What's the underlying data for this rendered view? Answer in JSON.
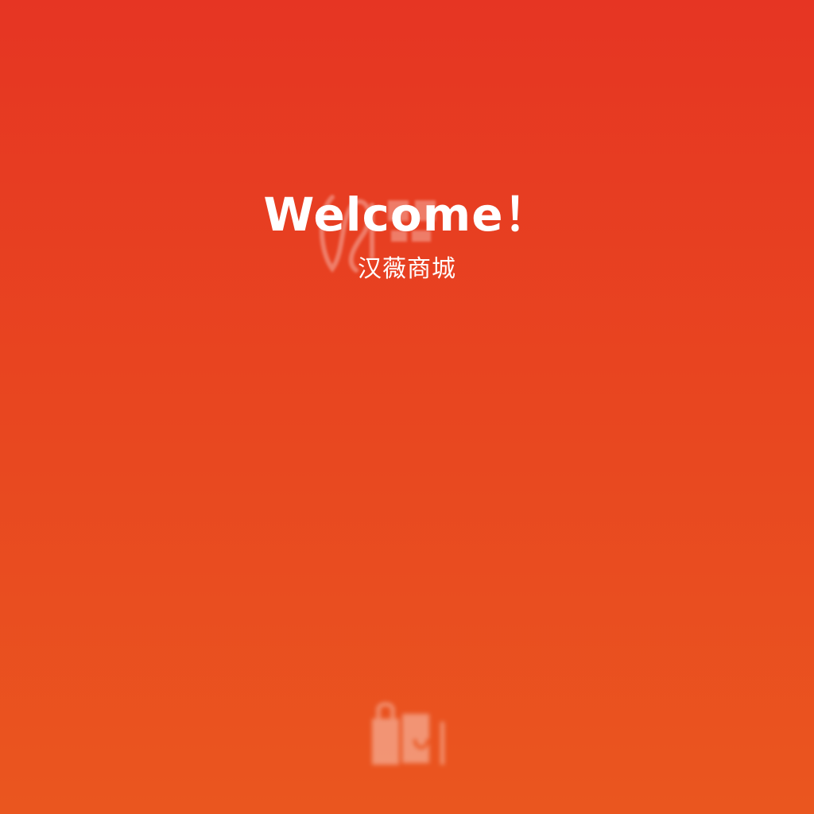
{
  "splash": {
    "welcome_text": "Welcome！",
    "app_name": "汉薇商城"
  },
  "icons": {
    "watermark": "brand-logo-watermark",
    "bottom": "shopping-bag-icon"
  },
  "colors": {
    "background_top": "#e63523",
    "background_bottom": "#ea561f",
    "text": "#ffffff"
  }
}
